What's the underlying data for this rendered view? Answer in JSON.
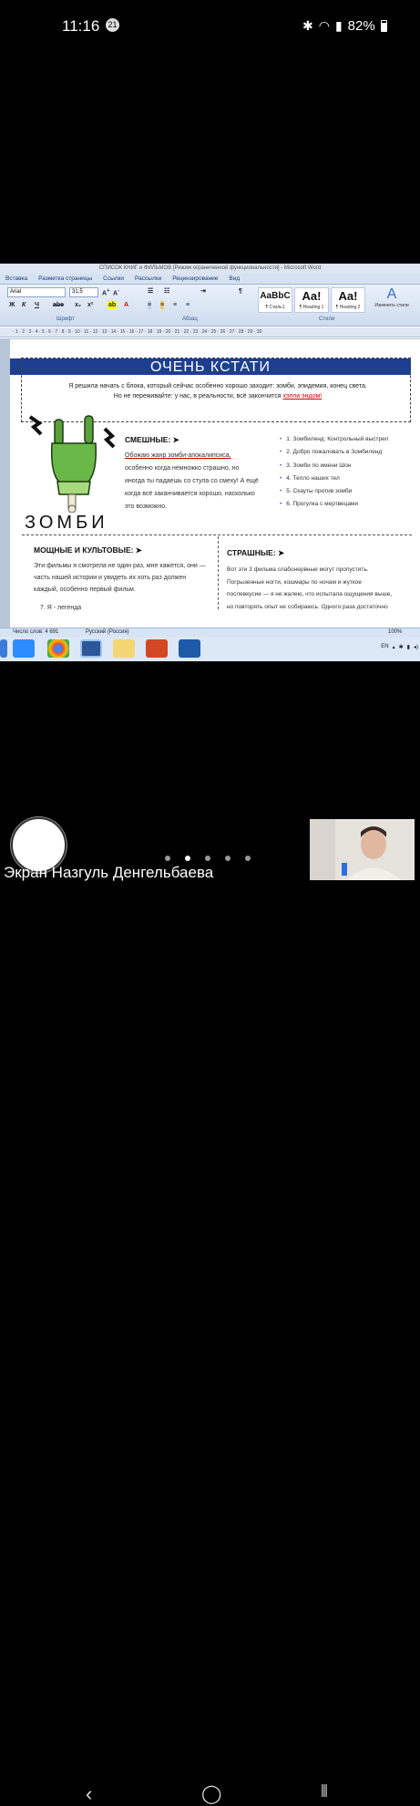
{
  "phone": {
    "time": "11:16",
    "badge": "21",
    "battery": "82%"
  },
  "word": {
    "window_title": "СПИСОК КНИГ и ФИЛЬМОВ [Режим ограниченной функциональности] - Microsoft Word",
    "tabs": [
      "Вставка",
      "Разметка страницы",
      "Ссылки",
      "Рассылки",
      "Рецензирование",
      "Вид"
    ],
    "font_name": "Arial",
    "font_size": "31,5",
    "group_labels": [
      "Шрифт",
      "Абзац",
      "Стили"
    ],
    "styles": [
      {
        "preview": "AaBbC",
        "name": "¶ Стиль1"
      },
      {
        "preview": "Aa!",
        "name": "¶ Heading 1"
      },
      {
        "preview": "Aa!",
        "name": "¶ Heading 2"
      }
    ],
    "change_styles": "Изменить стили",
    "status": {
      "words": "Число слов: 4 691",
      "lang": "Русский (Россия)",
      "zoom": "100%"
    },
    "tray_lang": "EN"
  },
  "doc": {
    "banner": "ОЧЕНЬ КСТАТИ",
    "intro1": "Я решила начать с блока, который сейчас особенно хорошо заходит: зомби, эпидемия, конец света.",
    "intro2a": "Но не переживайте: у нас, в реальности, всё закончится ",
    "intro2b": "хэппи эндом!",
    "zombie_word": "ЗОМБИ",
    "funny_h": "СМЕШНЫЕ: ➤",
    "funny_body": [
      "Обожаю жанр зомби-апокалипсиса,",
      "особенно когда немножко страшно, но",
      "иногда ты падаешь со стула со смеху! А ещё",
      "когда всё заканчивается хорошо, насколько",
      "это возможно."
    ],
    "funny_list": [
      "1. Зомбиленд: Контрольный выстрел",
      "2. Добро пожаловать в Зомбиленд",
      "3. Зомби по имени Шон",
      "4. Тепло наших тел",
      "5. Скауты против зомби",
      "6. Прогулка с мертвецами"
    ],
    "cult_h": "МОЩНЫЕ И КУЛЬТОВЫЕ: ➤",
    "cult_body": [
      "Эти фильмы я смотрела не один раз, мне кажется, они —",
      "часть нашей истории и увидеть их хоть раз должен",
      "каждый, особенно первый фильм."
    ],
    "cult_list_item": "7. Я - легенда",
    "scary_h": "СТРАШНЫЕ: ➤",
    "scary_body": [
      "Вот эти 3 фильма слабонервные могут пропустить.",
      "Погрызенные ногти, кошмары по ночам и жуткое",
      "послевкусие — я не жалею, что испытала ощущения выше,",
      "но повторять опыт не собираюсь. Одного раза достаточно"
    ]
  },
  "call": {
    "screen_label": "Экран Назгуль Денгельбаева"
  }
}
